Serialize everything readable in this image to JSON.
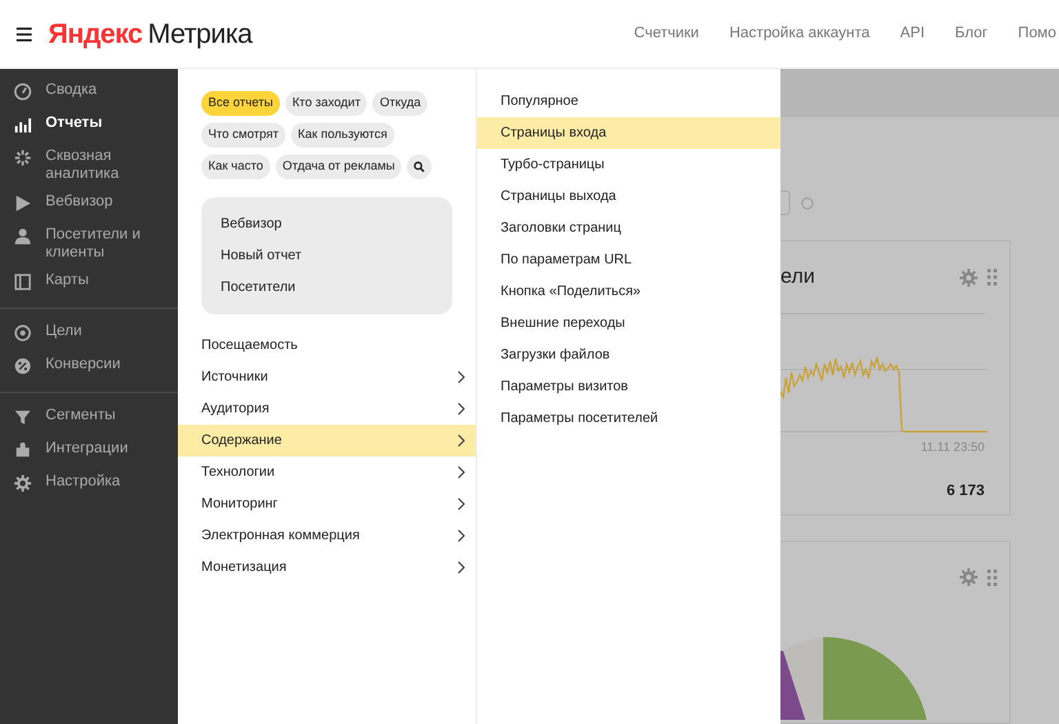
{
  "header": {
    "logo": {
      "brand": "Яндекс",
      "product": "Метрика"
    },
    "nav": [
      "Счетчики",
      "Настройка аккаунта",
      "API",
      "Блог",
      "Помо"
    ]
  },
  "sidebar": {
    "groups": [
      {
        "items": [
          {
            "label": "Сводка",
            "selected": false
          },
          {
            "label": "Отчеты",
            "selected": true
          },
          {
            "label": "Сквозная аналитика",
            "selected": false
          },
          {
            "label": "Вебвизор",
            "selected": false
          },
          {
            "label": "Посетители и клиенты",
            "selected": false
          },
          {
            "label": "Карты",
            "selected": false
          }
        ]
      },
      {
        "items": [
          {
            "label": "Цели",
            "selected": false
          },
          {
            "label": "Конверсии",
            "selected": false
          }
        ]
      },
      {
        "items": [
          {
            "label": "Сегменты",
            "selected": false
          },
          {
            "label": "Интеграции",
            "selected": false
          },
          {
            "label": "Настройка",
            "selected": false
          }
        ]
      }
    ]
  },
  "report_menu": {
    "filters": [
      {
        "label": "Все отчеты",
        "selected": true
      },
      {
        "label": "Кто заходит",
        "selected": false
      },
      {
        "label": "Откуда",
        "selected": false
      },
      {
        "label": "Что смотрят",
        "selected": false
      },
      {
        "label": "Как пользуются",
        "selected": false
      },
      {
        "label": "Как часто",
        "selected": false
      },
      {
        "label": "Отдача от рекламы",
        "selected": false
      }
    ],
    "quick_links": [
      "Вебвизор",
      "Новый отчет",
      "Посетители"
    ],
    "sections": [
      {
        "label": "Посещаемость",
        "expandable": false,
        "selected": false
      },
      {
        "label": "Источники",
        "expandable": true,
        "selected": false
      },
      {
        "label": "Аудитория",
        "expandable": true,
        "selected": false
      },
      {
        "label": "Содержание",
        "expandable": true,
        "selected": true
      },
      {
        "label": "Технологии",
        "expandable": true,
        "selected": false
      },
      {
        "label": "Мониторинг",
        "expandable": true,
        "selected": false
      },
      {
        "label": "Электронная коммерция",
        "expandable": true,
        "selected": false
      },
      {
        "label": "Монетизация",
        "expandable": true,
        "selected": false
      }
    ]
  },
  "submenu": {
    "items": [
      {
        "label": "Популярное",
        "selected": false
      },
      {
        "label": "Страницы входа",
        "selected": true
      },
      {
        "label": "Турбо-страницы",
        "selected": false
      },
      {
        "label": "Страницы выхода",
        "selected": false
      },
      {
        "label": "Заголовки страниц",
        "selected": false
      },
      {
        "label": "По параметрам URL",
        "selected": false
      },
      {
        "label": "Кнопка «Поделиться»",
        "selected": false
      },
      {
        "label": "Внешние переходы",
        "selected": false
      },
      {
        "label": "Загрузки файлов",
        "selected": false
      },
      {
        "label": "Параметры визитов",
        "selected": false
      },
      {
        "label": "Параметры посетителей",
        "selected": false
      }
    ]
  },
  "dashboard": {
    "widget_title": "ели",
    "time_label": "11.11 23:50",
    "total": "6 173"
  }
}
